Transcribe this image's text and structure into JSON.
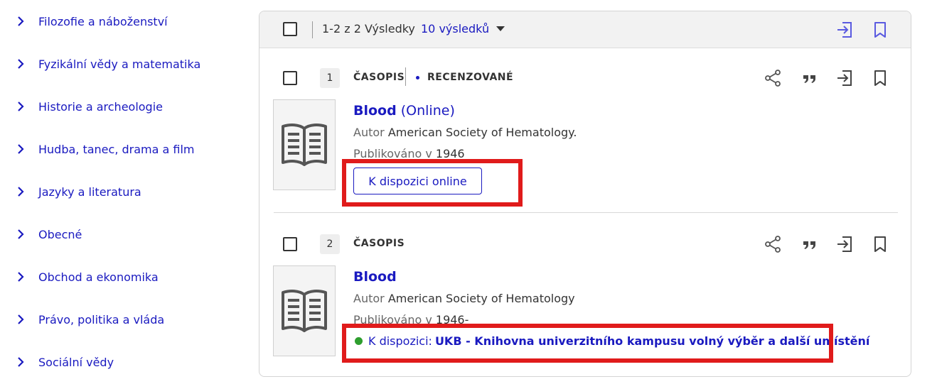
{
  "sidebar": {
    "items": [
      {
        "label": "Filozofie a náboženství"
      },
      {
        "label": "Fyzikální vědy a matematika"
      },
      {
        "label": "Historie a archeologie"
      },
      {
        "label": "Hudba, tanec, drama a film"
      },
      {
        "label": "Jazyky a literatura"
      },
      {
        "label": "Obecné"
      },
      {
        "label": "Obchod a ekonomika"
      },
      {
        "label": "Právo, politika a vláda"
      },
      {
        "label": "Sociální vědy"
      }
    ]
  },
  "results_header": {
    "count_text": "1-2 z 2 Výsledky",
    "per_page_label": "10 výsledků"
  },
  "records": [
    {
      "number": "1",
      "type": "ČASOPIS",
      "peer_reviewed": "RECENZOVANÉ",
      "title_main": "Blood",
      "title_suffix": " (Online)",
      "author_label": "Autor",
      "author": "American Society of Hematology.",
      "published_label": "Publikováno v",
      "published": "1946",
      "availability_button": "K dispozici online"
    },
    {
      "number": "2",
      "type": "ČASOPIS",
      "title_main": "Blood",
      "author_label": "Autor",
      "author": "American Society of Hematology",
      "published_label": "Publikováno v",
      "published": "1946-",
      "availability_label": "K dispozici:",
      "availability_location": "UKB - Knihovna univerzitního kampusu volný výběr a další umístění",
      "availability_status_color": "#2e9e2e"
    }
  ],
  "colors": {
    "link": "#1a1ac0",
    "highlight": "#e01b1b"
  }
}
